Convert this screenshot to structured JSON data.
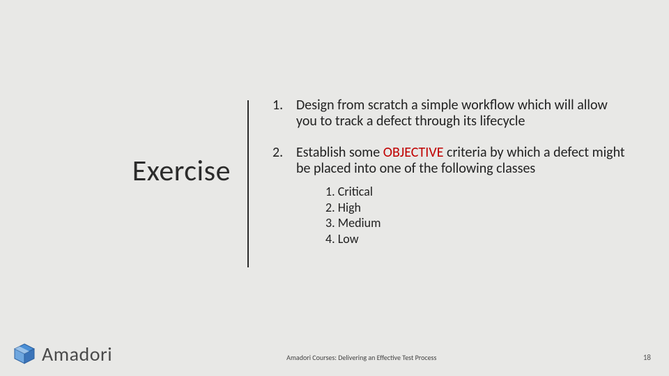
{
  "title": "Exercise",
  "items": [
    {
      "num": "1.",
      "text": "Design from scratch a simple workflow which will allow you to track a defect through its lifecycle"
    },
    {
      "num": "2.",
      "text_pre": "Establish some ",
      "text_hi": "OBJECTIVE",
      "text_post": " criteria by which a defect might be placed into one of the following classes",
      "sub": [
        {
          "line": "1. Critical"
        },
        {
          "line": "2. High"
        },
        {
          "line": "3. Medium"
        },
        {
          "line": "4. Low"
        }
      ]
    }
  ],
  "footer": {
    "course": "Amadori Courses: Delivering an Effective Test Process",
    "page": "18",
    "brand": "Amadori"
  }
}
